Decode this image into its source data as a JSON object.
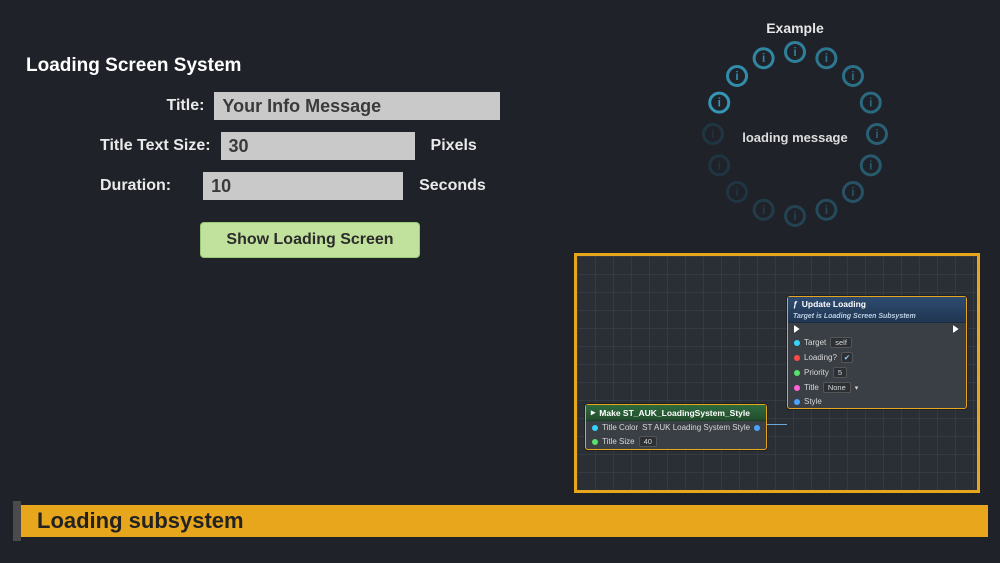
{
  "panel": {
    "title": "Loading Screen System"
  },
  "form": {
    "title_label": "Title:",
    "title_value": "Your Info Message",
    "size_label": "Title Text Size:",
    "size_value": "30",
    "size_suffix": "Pixels",
    "duration_label": "Duration:",
    "duration_value": "10",
    "duration_suffix": "Seconds",
    "show_button": "Show Loading Screen"
  },
  "example": {
    "heading": "Example",
    "message": "loading message"
  },
  "blueprint": {
    "make_node": {
      "title": "Make ST_AUK_LoadingSystem_Style",
      "color_pin": "Title Color",
      "size_pin": "Title Size",
      "size_value": "40",
      "out_pin": "ST AUK Loading System Style"
    },
    "update_node": {
      "title": "Update Loading",
      "subtitle": "Target is Loading Screen Subsystem",
      "target_pin": "Target",
      "target_value": "self",
      "loading_pin": "Loading?",
      "loading_checked": true,
      "priority_pin": "Priority",
      "priority_value": "5",
      "title_pin": "Title",
      "title_value": "None",
      "style_pin": "Style"
    }
  },
  "banner": {
    "text": "Loading subsystem"
  }
}
